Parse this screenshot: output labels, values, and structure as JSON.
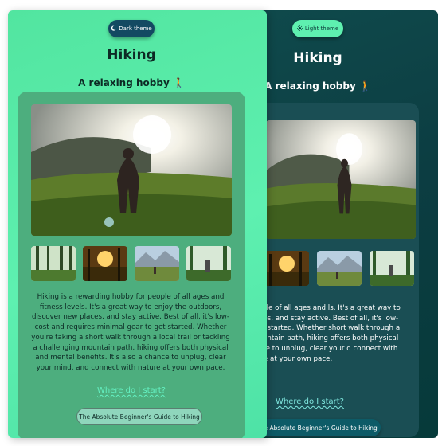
{
  "light_panel": {
    "theme_button": {
      "icon": "moon-icon",
      "label": "Dark theme"
    },
    "title": "Hiking",
    "subtitle": "A relaxing hobby 🚶",
    "paragraph": "Hiking is a rewarding hobby for people of all ages and fitness levels. It's a great way to enjoy the outdoors, discover new places, and stay active. Best of all, it's low-cost and requires minimal gear to get started. Whether you're taking a short walk through a local trail or tackling a challenging mountain path, hiking offers both physical and mental benefits. It's also a chance to unplug, clear your mind, and connect with nature at your own pace.",
    "link": "Where do I start?",
    "guide_button": "The Absolute Beginner's Guide to Hiking"
  },
  "dark_panel": {
    "theme_button": {
      "icon": "sun-icon",
      "label": "Light theme"
    },
    "title": "Hiking",
    "subtitle": "A relaxing hobby 🚶",
    "paragraph": "rewarding hobby for people of all ages and ls. It's a great way to enjoy the outdoors, places, and stay active. Best of all, it's low- uires minimal gear to get started. Whether short walk through a local trail or tackling a ountain path, hiking offers both physical and fits. It's also a chance to unplug, clear your d connect with nature at your own pace.",
    "link": "Where do I start?",
    "guide_button": "The Absolute Beginner's Guide to Hiking"
  },
  "images": {
    "hero": "hiker-in-sunlight-photo",
    "thumbnails": [
      "forest-photo",
      "sunset-forest-photo",
      "mountain-hikers-photo",
      "forest-hiker-photo"
    ]
  },
  "colors": {
    "light_bg": "#5ef0b0",
    "light_card": "#4dae7e",
    "dark_bg": "#0c3d42",
    "dark_card": "#1a4e54",
    "link_light": "#64f2c3",
    "link_dark": "#7fe7df"
  }
}
